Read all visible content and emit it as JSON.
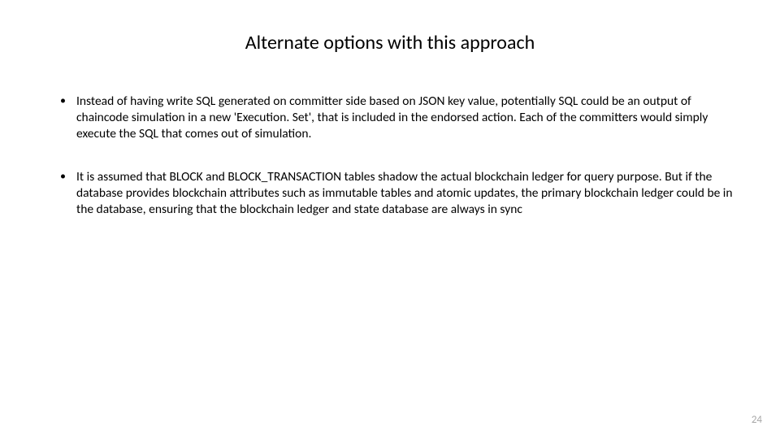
{
  "title": "Alternate options with this approach",
  "bullets": [
    "Instead of having write SQL generated on committer side based on JSON key value, potentially SQL could be an output of chaincode simulation in a new 'Execution. Set', that is included in the endorsed action.  Each of the committers would simply execute the SQL that comes out of simulation.",
    "It is assumed that BLOCK and BLOCK_TRANSACTION tables shadow the actual blockchain ledger for query purpose.  But if the database provides blockchain attributes such as immutable tables and atomic updates, the primary blockchain ledger could be in the database, ensuring that the blockchain ledger and state database are always in sync"
  ],
  "page_number": "24"
}
